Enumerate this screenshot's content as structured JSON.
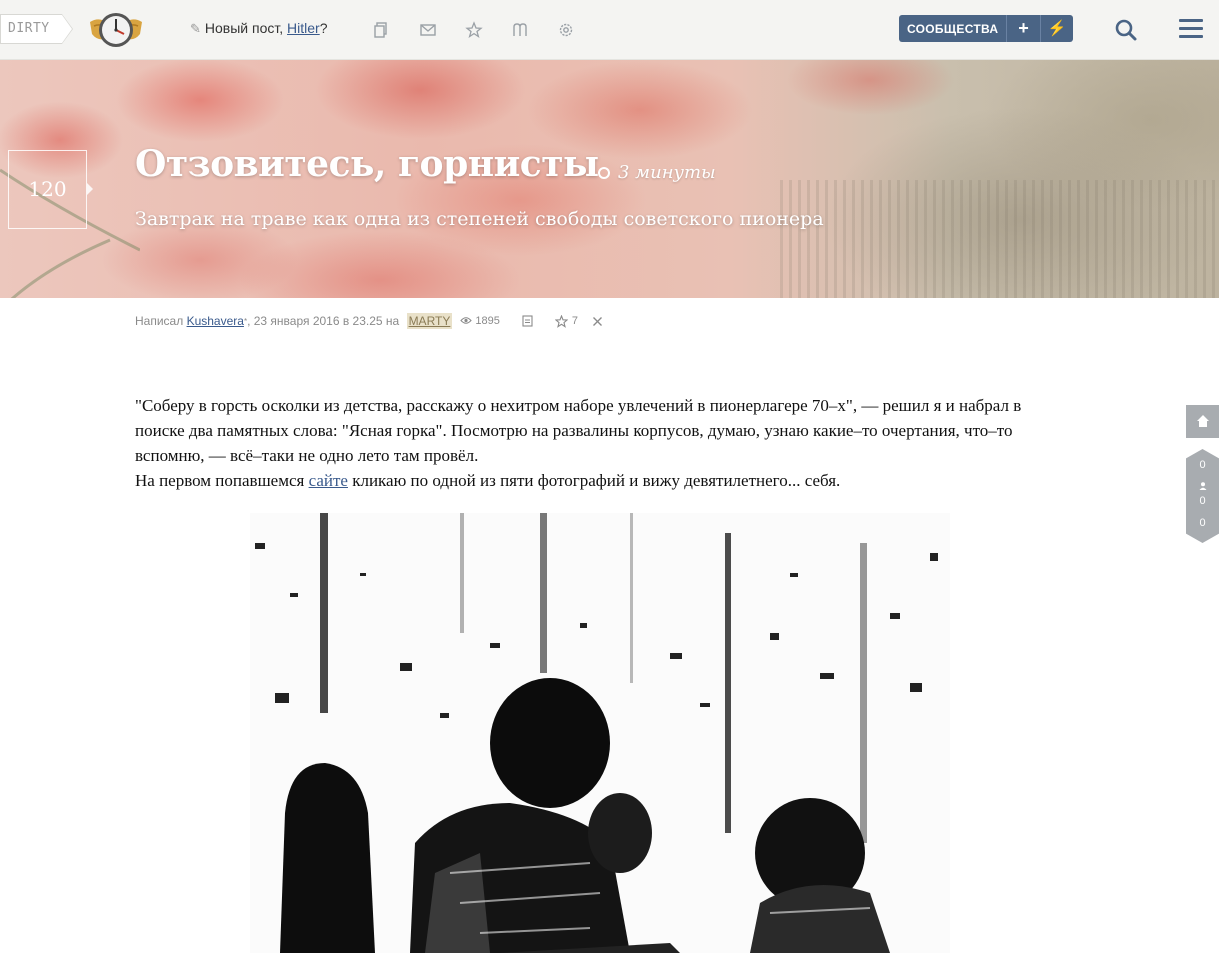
{
  "topbar": {
    "brand": "DIRTY",
    "new_post_prefix": "Новый пост, ",
    "new_post_user": "Hitler",
    "new_post_suffix": "?",
    "communities_label": "СООБЩЕСТВА",
    "plus": "+",
    "bolt": "⚡"
  },
  "post": {
    "score": "120",
    "title": "Отзовитесь, горнисты",
    "read_time": "3 минуты",
    "subtitle": "Завтрак на траве как одна из степеней свободы советского пионера"
  },
  "meta": {
    "written_by": "Написал ",
    "author": "Kushavera",
    "author_mark": "*",
    "date_prefix": ", 23 января 2016 в 23.25 на ",
    "community": "MARTY",
    "views": "1895",
    "favorites": "7"
  },
  "article": {
    "paragraph1": "\"Соберу в горсть осколки из детства, расскажу о нехитром наборе увлечений в пионерлагере 70–х\", — решил я и набрал в поиске два памятных слова: \"Ясная горка\". Посмотрю на развалины корпусов, думаю, узнаю какие–то очертания, что–то вспомню, — всё–таки не одно лето там провёл.",
    "p2_before": "На первом попавшемся ",
    "p2_link": "сайте",
    "p2_after": " кликаю по одной из пяти фотографий и вижу девятилетнего... себя."
  },
  "side": {
    "count1": "0",
    "count2": "0",
    "count3": "0"
  },
  "colors": {
    "accent": "#4a6485",
    "link": "#3a5a8c",
    "tag_bg": "#e9e1c9"
  }
}
